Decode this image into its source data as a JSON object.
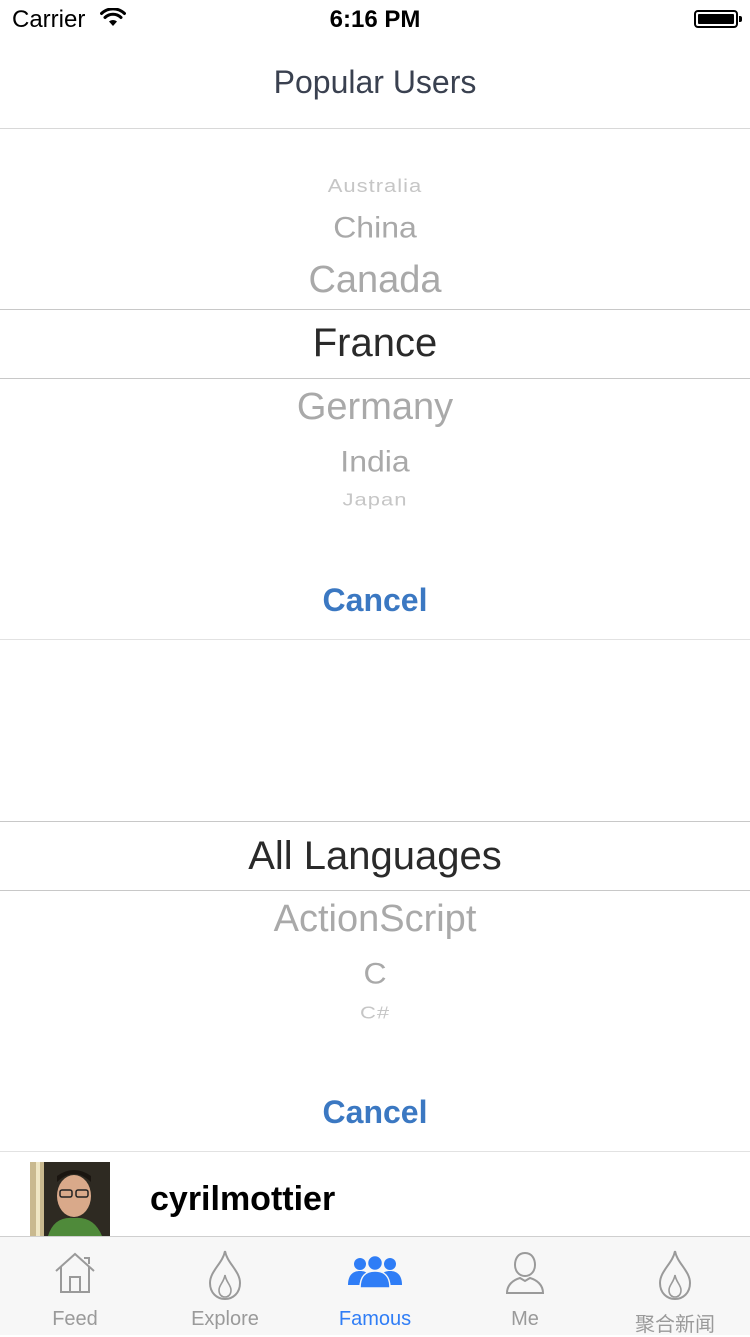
{
  "status_bar": {
    "carrier": "Carrier",
    "time": "6:16 PM"
  },
  "nav": {
    "title": "Popular Users"
  },
  "country_picker": {
    "above": [
      "Australia",
      "China",
      "Canada"
    ],
    "selected": "France",
    "below": [
      "Germany",
      "India",
      "Japan"
    ],
    "cancel_label": "Cancel"
  },
  "language_picker": {
    "selected": "All Languages",
    "below": [
      "ActionScript",
      "C",
      "C#"
    ],
    "cancel_label": "Cancel"
  },
  "user_list": [
    {
      "username": "cyrilmottier"
    }
  ],
  "tab_bar": {
    "items": [
      {
        "label": "Feed",
        "icon": "home-icon"
      },
      {
        "label": "Explore",
        "icon": "flame-icon"
      },
      {
        "label": "Famous",
        "icon": "users-group-icon"
      },
      {
        "label": "Me",
        "icon": "person-icon"
      },
      {
        "label": "聚合新闻",
        "icon": "flame-icon"
      }
    ],
    "active_index": 2
  },
  "colors": {
    "accent": "#2f7df6",
    "cancel": "#3b78c2",
    "title": "#3a4150"
  }
}
